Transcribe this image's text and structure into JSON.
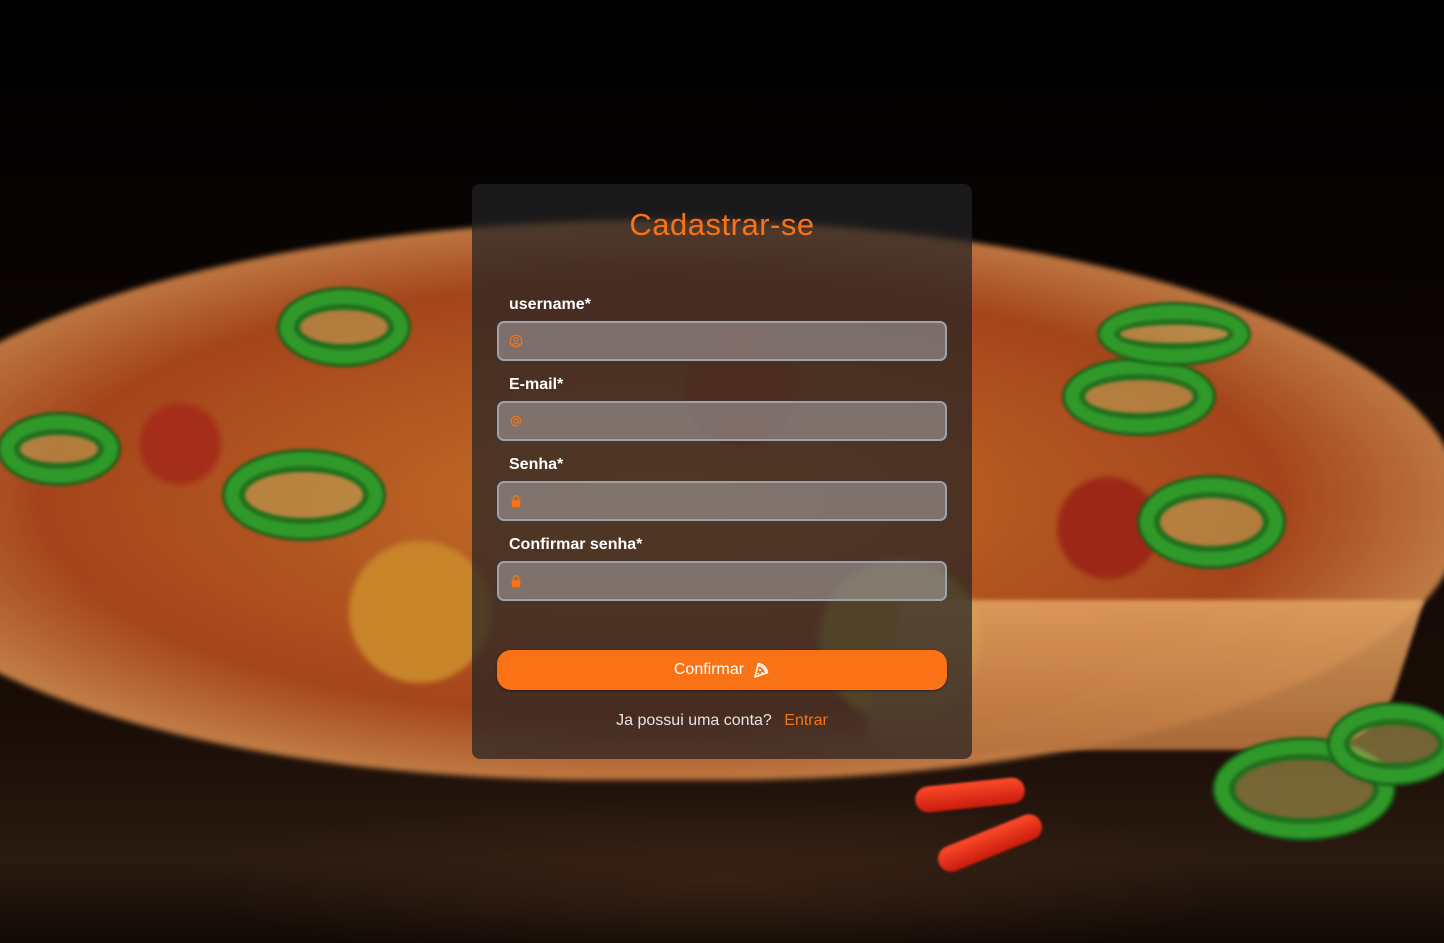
{
  "page": {
    "title": "Cadastrar-se"
  },
  "form": {
    "fields": [
      {
        "label": "username*",
        "icon": "user-circle-icon",
        "value": "",
        "placeholder": ""
      },
      {
        "label": "E-mail*",
        "icon": "at-sign-icon",
        "value": "",
        "placeholder": ""
      },
      {
        "label": "Senha*",
        "icon": "lock-icon",
        "value": "",
        "placeholder": ""
      },
      {
        "label": "Confirmar senha*",
        "icon": "lock-icon",
        "value": "",
        "placeholder": ""
      }
    ],
    "submit_label": "Confirmar",
    "submit_icon": "pizza-slice-icon"
  },
  "footer": {
    "question": "Ja possui uma conta?",
    "link_label": "Entrar"
  },
  "colors": {
    "accent": "#f97316",
    "card_bg": "#222224",
    "label_text": "#ffffff"
  }
}
